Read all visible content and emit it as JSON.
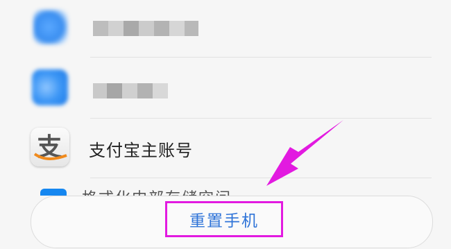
{
  "items": [
    {
      "label": "",
      "icon": "blurred-app-icon"
    },
    {
      "label": "",
      "icon": "blurred-app-icon"
    },
    {
      "label": "支付宝主账号",
      "icon": "alipay-icon"
    },
    {
      "label": "格式化内部存储空间",
      "icon": "storage-icon"
    }
  ],
  "reset_button": {
    "label": "重置手机"
  },
  "colors": {
    "accent": "#2f74d8",
    "highlight": "#e21ae0",
    "alipay_blue": "#1687f0"
  }
}
